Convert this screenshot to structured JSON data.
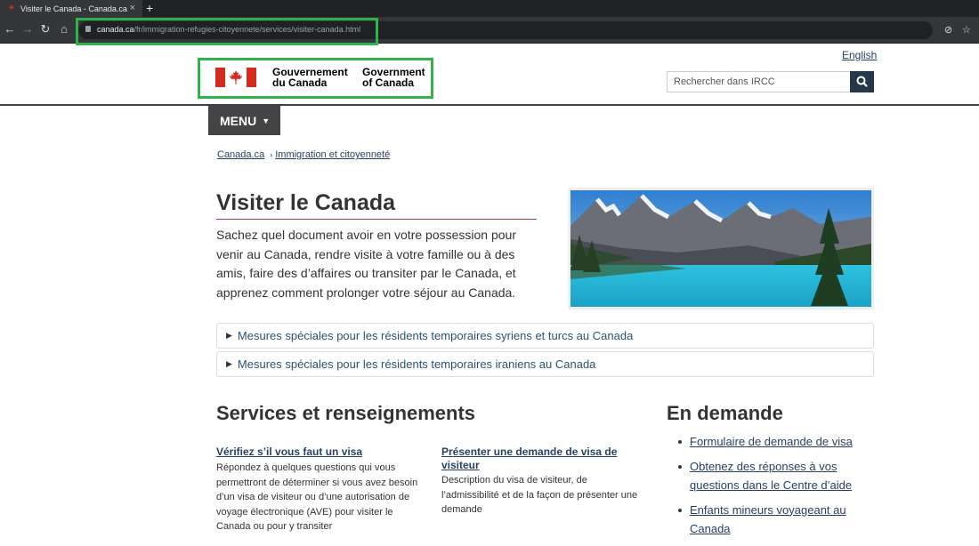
{
  "browser": {
    "tab_title": "Visiter le Canada - Canada.ca",
    "new_tab": "+",
    "url_host": "canada.ca",
    "url_path": "/fr/immigration-refugies-citoyennete/services/visiter-canada.html"
  },
  "header": {
    "language_toggle": "English",
    "signature_fr_1": "Gouvernement",
    "signature_fr_2": "du Canada",
    "signature_en_1": "Government",
    "signature_en_2": "of Canada",
    "search_placeholder": "Rechercher dans IRCC",
    "menu_label": "MENU"
  },
  "breadcrumb": [
    "Canada.ca",
    "Immigration et citoyenneté"
  ],
  "main": {
    "title": "Visiter le Canada",
    "intro": "Sachez quel document avoir en votre possession pour venir au Canada, rendre visite à votre famille ou à des amis, faire des d’affaires ou transiter par le Canada, et apprenez comment prolonger votre séjour au Canada.",
    "details": [
      "Mesures spéciales pour les résidents temporaires syriens et turcs au Canada",
      "Mesures spéciales pour les résidents temporaires iraniens au Canada"
    ]
  },
  "services": {
    "heading": "Services et renseignements",
    "items": [
      {
        "link": "Vérifiez s’il vous faut un visa",
        "desc": "Répondez à quelques questions qui vous permettront de déterminer si vous avez besoin d’un visa de visiteur ou d’une autorisation de voyage électronique (AVE) pour visiter le Canada ou pour y transiter"
      },
      {
        "link": "Présenter une demande de visa de visiteur",
        "desc": "Description du visa de visiteur, de l’admissibilité et de la façon de présenter une demande"
      }
    ]
  },
  "in_demand": {
    "heading": "En demande",
    "items": [
      "Formulaire de demande de visa",
      "Obtenez des réponses à vos questions dans le Centre d’aide",
      "Enfants mineurs voyageant au Canada"
    ]
  },
  "colors": {
    "flag_red": "#d52b1e",
    "link": "#284162",
    "highlight": "#2eb34a",
    "menu_bg": "#444444"
  }
}
